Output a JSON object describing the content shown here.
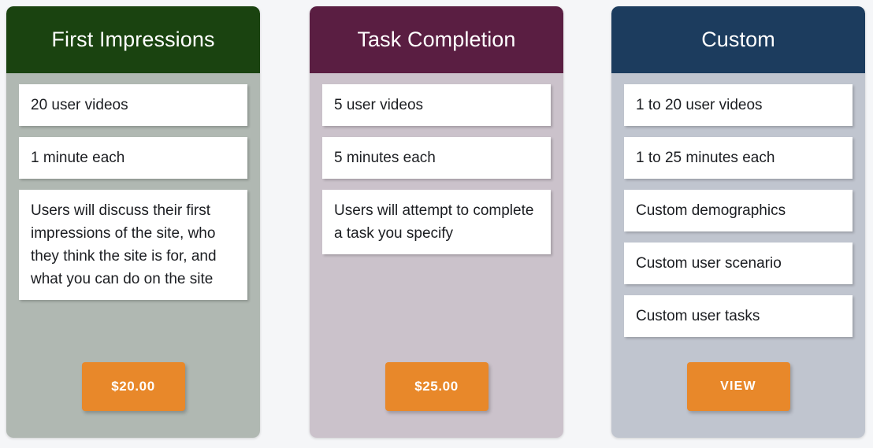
{
  "page": {
    "background_color": "#f5f6f8",
    "accent_color": "#e8882a"
  },
  "plans": [
    {
      "title": "First Impressions",
      "header_color": "#1a4310",
      "body_color": "#b0b8b2",
      "features": [
        "20 user videos",
        "1 minute each",
        "Users will discuss their first impressions of the site, who they think the site is for, and what you can do on the site"
      ],
      "cta_label": "$20.00",
      "cta_style": "price"
    },
    {
      "title": "Task Completion",
      "header_color": "#5a1e42",
      "body_color": "#cbc2cb",
      "features": [
        "5 user videos",
        "5 minutes each",
        "Users will attempt to complete a task you specify"
      ],
      "cta_label": "$25.00",
      "cta_style": "price"
    },
    {
      "title": "Custom",
      "header_color": "#1c3c5e",
      "body_color": "#c0c5cf",
      "features": [
        "1 to 20 user videos",
        "1 to 25 minutes each",
        "Custom demographics",
        "Custom user scenario",
        "Custom user tasks"
      ],
      "cta_label": "VIEW",
      "cta_style": "action"
    }
  ]
}
